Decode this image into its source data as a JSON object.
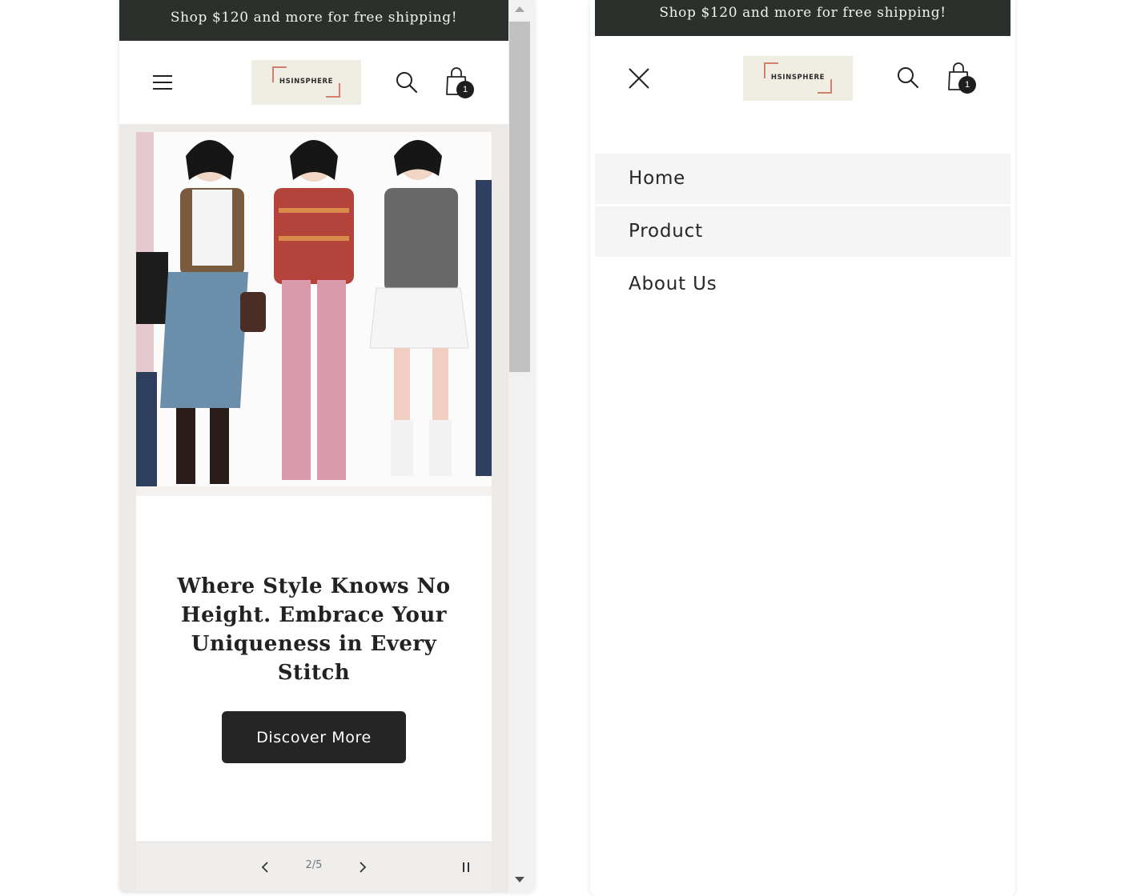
{
  "announcement": "Shop $120 and more for free shipping!",
  "logo_text": "HSINSPHERE",
  "cart_count": "1",
  "hero": {
    "heading": "Where Style Knows No Height. Embrace Your Uniqueness in Every Stitch",
    "button_label": "Discover More"
  },
  "slider": {
    "counter": "2/5",
    "current": 2,
    "total": 5
  },
  "menu": {
    "items": [
      {
        "label": "Home",
        "active": true
      },
      {
        "label": "Product",
        "active": true
      },
      {
        "label": "About Us",
        "active": false
      }
    ]
  },
  "colors": {
    "announcement_bg": "#2b302d",
    "logo_bg": "#f0ede3",
    "logo_accent": "#d27f6e",
    "button_bg": "#252525",
    "slide_bg": "#ede9e6"
  }
}
